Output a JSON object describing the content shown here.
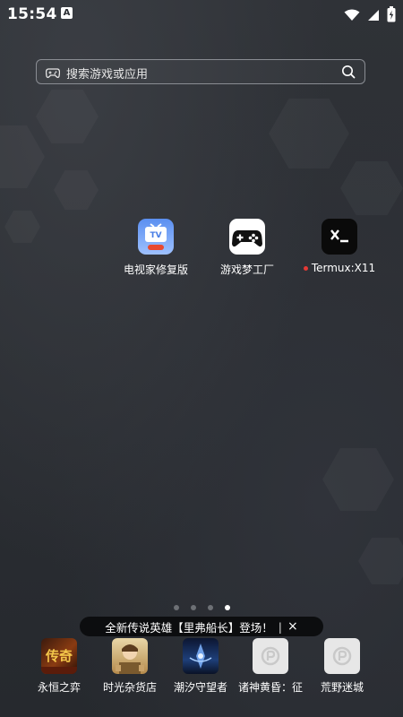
{
  "status_bar": {
    "time": "15:54",
    "notification_badge": "A",
    "icons": [
      "wifi-icon",
      "signal-icon",
      "battery-charging-icon"
    ]
  },
  "search": {
    "placeholder": "搜索游戏或应用",
    "left_icon": "gamepad-icon",
    "right_icon": "search-icon"
  },
  "apps": [
    {
      "label": "电视家修复版",
      "icon": "tv-app-icon"
    },
    {
      "label": "游戏梦工厂",
      "icon": "gamepad-app-icon"
    },
    {
      "label": "Termux:X11",
      "icon": "terminal-icon",
      "badge": "red-dot"
    }
  ],
  "pager": {
    "pages": 4,
    "active_index": 3
  },
  "banner": {
    "text": "全新传说英雄【里弗船长】登场！",
    "separator": "|",
    "close": "×"
  },
  "dock": [
    {
      "label": "永恒之弈",
      "icon": "game-yongheng-icon"
    },
    {
      "label": "时光杂货店",
      "icon": "game-shiguang-icon"
    },
    {
      "label": "潮汐守望者",
      "icon": "game-chaoxi-icon"
    },
    {
      "label": "诸神黄昏：征",
      "icon": "placeholder-game-icon"
    },
    {
      "label": "荒野迷城",
      "icon": "placeholder-game-icon"
    }
  ],
  "colors": {
    "background": "#2b2e33",
    "tv_icon_gradient": [
      "#5b8ff0",
      "#9ec1ff"
    ],
    "termux_bg": "#0a0a0a"
  }
}
